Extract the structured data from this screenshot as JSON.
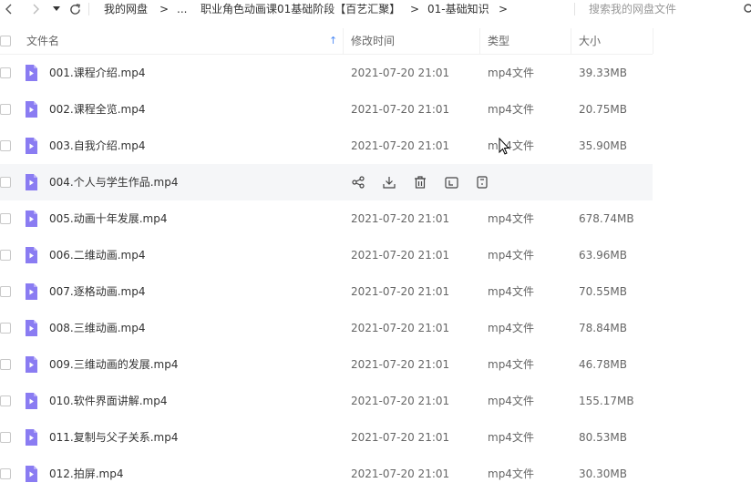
{
  "toolbar": {
    "breadcrumbs": [
      "我的网盘",
      ">",
      "...",
      "职业角色动画课01基础阶段【百艺汇聚】",
      ">",
      "01-基础知识",
      ">"
    ],
    "search_placeholder": "搜索我的网盘文件"
  },
  "header": {
    "name": "文件名",
    "modified": "修改时间",
    "type": "类型",
    "size": "大小",
    "sort_arrow": "↑"
  },
  "colors": {
    "accent": "#4e8bf5",
    "file_icon": "#8a7cf2",
    "hover_row": "#f5f6f8"
  },
  "files": [
    {
      "name": "001.课程介绍.mp4",
      "date": "2021-07-20 21:01",
      "type": "mp4文件",
      "size": "39.33MB"
    },
    {
      "name": "002.课程全览.mp4",
      "date": "2021-07-20 21:01",
      "type": "mp4文件",
      "size": "20.75MB"
    },
    {
      "name": "003.自我介绍.mp4",
      "date": "2021-07-20 21:01",
      "type": "mp4文件",
      "size": "35.90MB"
    },
    {
      "name": "004.个人与学生作品.mp4",
      "date": "",
      "type": "",
      "size": "",
      "hovered": true
    },
    {
      "name": "005.动画十年发展.mp4",
      "date": "2021-07-20 21:01",
      "type": "mp4文件",
      "size": "678.74MB"
    },
    {
      "name": "006.二维动画.mp4",
      "date": "2021-07-20 21:01",
      "type": "mp4文件",
      "size": "63.96MB"
    },
    {
      "name": "007.逐格动画.mp4",
      "date": "2021-07-20 21:01",
      "type": "mp4文件",
      "size": "70.55MB"
    },
    {
      "name": "008.三维动画.mp4",
      "date": "2021-07-20 21:01",
      "type": "mp4文件",
      "size": "78.84MB"
    },
    {
      "name": "009.三维动画的发展.mp4",
      "date": "2021-07-20 21:01",
      "type": "mp4文件",
      "size": "46.78MB"
    },
    {
      "name": "010.软件界面讲解.mp4",
      "date": "2021-07-20 21:01",
      "type": "mp4文件",
      "size": "155.17MB"
    },
    {
      "name": "011.复制与父子关系.mp4",
      "date": "2021-07-20 21:01",
      "type": "mp4文件",
      "size": "80.53MB"
    },
    {
      "name": "012.拍屏.mp4",
      "date": "2021-07-20 21:01",
      "type": "mp4文件",
      "size": "30.30MB"
    }
  ],
  "row_actions": [
    "share-icon",
    "download-icon",
    "delete-icon",
    "rename-icon",
    "more-icon"
  ]
}
